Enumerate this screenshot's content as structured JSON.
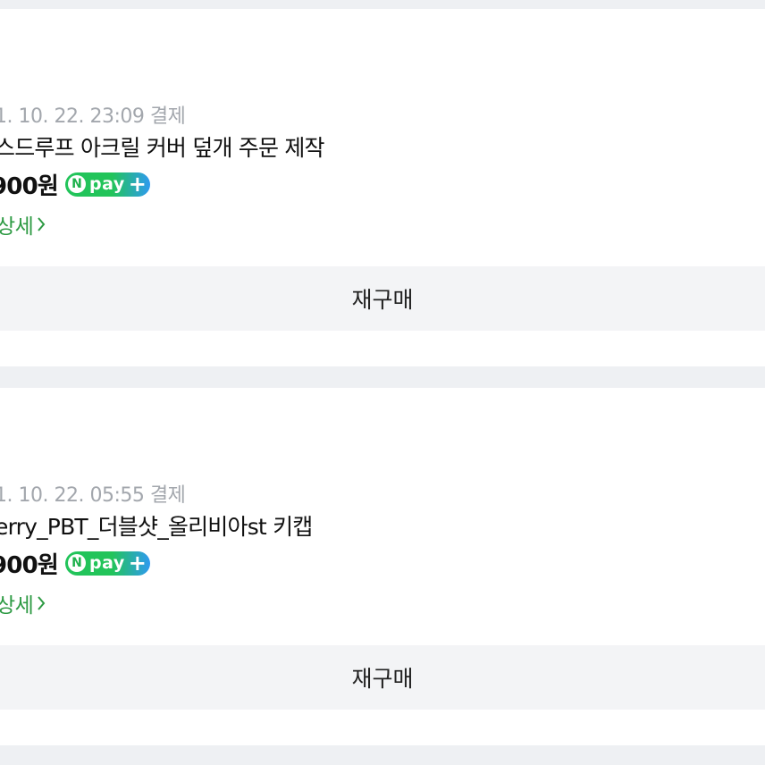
{
  "orders": [
    {
      "date": "1. 10. 22. 23:09 결제",
      "title": "스드루프 아크릴 커버 덮개 주문 제작",
      "price": "900원",
      "npay": {
        "badge": "N",
        "label": "pay",
        "plus": "+"
      },
      "detail_label": "상세",
      "rebuy_label": "재구매"
    },
    {
      "date": "1. 10. 22. 05:55 결제",
      "title": "erry_PBT_더블샷_올리비아st 키캡",
      "price": "900원",
      "npay": {
        "badge": "N",
        "label": "pay",
        "plus": "+"
      },
      "detail_label": "상세",
      "rebuy_label": "재구매"
    }
  ],
  "colors": {
    "background": "#eef0f3",
    "card": "#ffffff",
    "date_text": "#a3a7ad",
    "detail_link": "#2d9a43",
    "rebuy_button": "#f3f4f6",
    "npay_green": "#22c45a",
    "npay_blue": "#2f9af0"
  },
  "icons": {
    "detail_chevron": "chevron-right-icon",
    "npay_logo": "naver-pay-icon"
  }
}
